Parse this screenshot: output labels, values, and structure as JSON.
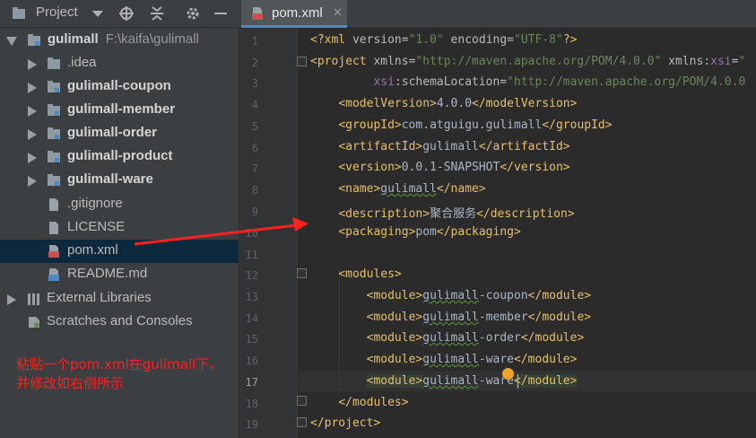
{
  "project_panel": {
    "title": "Project",
    "icons": [
      "dropdown-caret-icon",
      "crosshair-icon",
      "collapse-all-icon",
      "gear-icon",
      "minimize-icon"
    ],
    "tree": [
      {
        "label": "gulimall",
        "hint": "F:\\kaifa\\gulimall",
        "expanded": true,
        "bold": true,
        "icon": "module-folder-icon"
      },
      {
        "label": ".idea",
        "expanded": false,
        "bold": false,
        "icon": "folder-icon"
      },
      {
        "label": "gulimall-coupon",
        "expanded": false,
        "bold": true,
        "icon": "module-folder-icon"
      },
      {
        "label": "gulimall-member",
        "expanded": false,
        "bold": true,
        "icon": "module-folder-icon"
      },
      {
        "label": "gulimall-order",
        "expanded": false,
        "bold": true,
        "icon": "module-folder-icon"
      },
      {
        "label": "gulimall-product",
        "expanded": false,
        "bold": true,
        "icon": "module-folder-icon"
      },
      {
        "label": "gulimall-ware",
        "expanded": false,
        "bold": true,
        "icon": "module-folder-icon"
      },
      {
        "label": ".gitignore",
        "bold": false,
        "icon": "file-icon"
      },
      {
        "label": "LICENSE",
        "bold": false,
        "icon": "file-icon"
      },
      {
        "label": "pom.xml",
        "bold": false,
        "icon": "xml-file-icon",
        "selected": true
      },
      {
        "label": "README.md",
        "bold": false,
        "icon": "markdown-file-icon"
      },
      {
        "label": "External Libraries",
        "expanded": false,
        "bold": false,
        "icon": "libraries-icon"
      },
      {
        "label": "Scratches and Consoles",
        "bold": false,
        "icon": "scratches-icon"
      }
    ]
  },
  "editor": {
    "tab": {
      "label": "pom.xml",
      "close": "✕"
    },
    "line_numbers": [
      "1",
      "2",
      "3",
      "4",
      "5",
      "6",
      "7",
      "8",
      "9",
      "10",
      "11",
      "12",
      "13",
      "14",
      "15",
      "16",
      "17",
      "18",
      "19"
    ],
    "lines": [
      "<?xml version=\"1.0\" encoding=\"UTF-8\"?>",
      "<project xmlns=\"http://maven.apache.org/POM/4.0.0\" xmlns:xsi=\"",
      "         xsi:schemaLocation=\"http://maven.apache.org/POM/4.0.0",
      "    <modelVersion>4.0.0</modelVersion>",
      "    <groupId>com.atguigu.gulimall</groupId>",
      "    <artifactId>gulimall</artifactId>",
      "    <version>0.0.1-SNAPSHOT</version>",
      "    <name>gulimall</name>",
      "    <description>聚合服务</description>",
      "    <packaging>pom</packaging>",
      "",
      "    <modules>",
      "        <module>gulimall-coupon</module>",
      "        <module>gulimall-member</module>",
      "        <module>gulimall-order</module>",
      "        <module>gulimall-ware</module>",
      "        <module>gulimall-ware</module>",
      "    </modules>",
      "</project>"
    ]
  },
  "annotation": {
    "line1": "粘贴一个pom.xml在gulimall下，",
    "line2": "并修改如右侧所示",
    "color": "#ff2020"
  }
}
